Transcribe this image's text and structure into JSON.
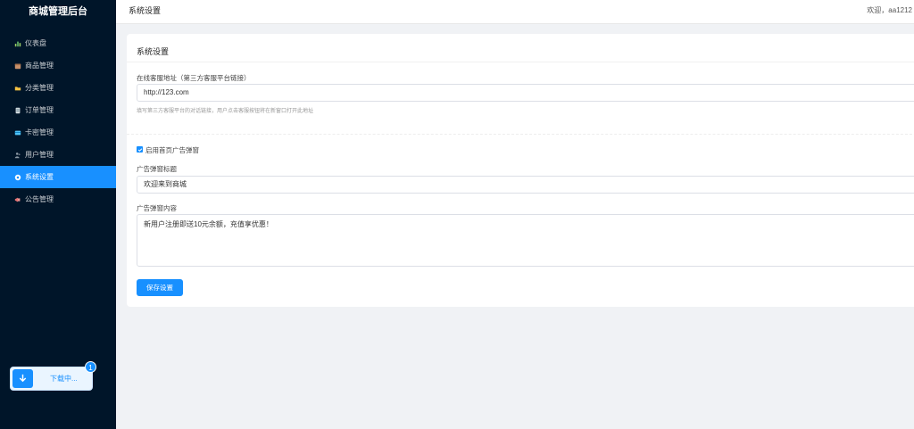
{
  "sidebar": {
    "brand": "商城管理后台",
    "items": [
      {
        "label": "仪表盘",
        "icon": "chart-icon"
      },
      {
        "label": "商品管理",
        "icon": "box-icon"
      },
      {
        "label": "分类管理",
        "icon": "folder-icon"
      },
      {
        "label": "订单管理",
        "icon": "clipboard-icon"
      },
      {
        "label": "卡密管理",
        "icon": "card-icon"
      },
      {
        "label": "用户管理",
        "icon": "users-icon"
      },
      {
        "label": "系统设置",
        "icon": "gear-icon",
        "active": true
      },
      {
        "label": "公告管理",
        "icon": "megaphone-icon"
      }
    ]
  },
  "download": {
    "label": "下载中...",
    "badge": "1"
  },
  "header": {
    "title": "系统设置",
    "welcome": "欢迎，aa1212"
  },
  "settings": {
    "card_title": "系统设置",
    "service_url_label": "在线客服地址（第三方客服平台链接）",
    "service_url_value": "http://123.com",
    "service_url_hint": "填写第三方客服平台的对话链接，用户点击客服按钮将在新窗口打开此地址",
    "enable_popup_label": "启用首页广告弹窗",
    "enable_popup_checked": true,
    "popup_title_label": "广告弹窗标题",
    "popup_title_value": "欢迎来到商城",
    "popup_content_label": "广告弹窗内容",
    "popup_content_value": "新用户注册即送10元余额，充值享优惠！",
    "save_label": "保存设置"
  },
  "colors": {
    "sidebar_bg": "#001529",
    "accent": "#1890ff",
    "page_bg": "#f0f2f5"
  }
}
